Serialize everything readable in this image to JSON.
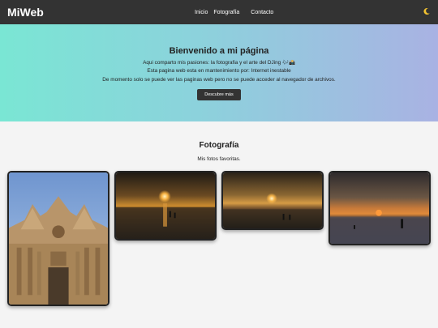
{
  "navbar": {
    "brand": "MiWeb",
    "links": [
      "Inicio",
      "Fotografía",
      "Contacto"
    ],
    "theme_icon": "moon-icon"
  },
  "hero": {
    "title": "Bienvenido a mi página",
    "line1": "Aqui comparto mis pasiones: la fotografia y el arte del DJing 🎶📸",
    "line2": "Esta pagina web esta en mantenimiento por: Internet inestable",
    "line3": "De momento solo se puede ver las paginas web pero no se puede acceder al navegador de archivos.",
    "button": "Descubre más",
    "gradient_colors": [
      "#7ae6d4",
      "#a9b2e3"
    ]
  },
  "gallery": {
    "title": "Fotografía",
    "subtitle": "Mis fotos favoritas.",
    "photos": [
      "cathedral-photo",
      "sunset-beach-photo-1",
      "sunset-beach-photo-2",
      "sunset-beach-photo-3"
    ]
  }
}
